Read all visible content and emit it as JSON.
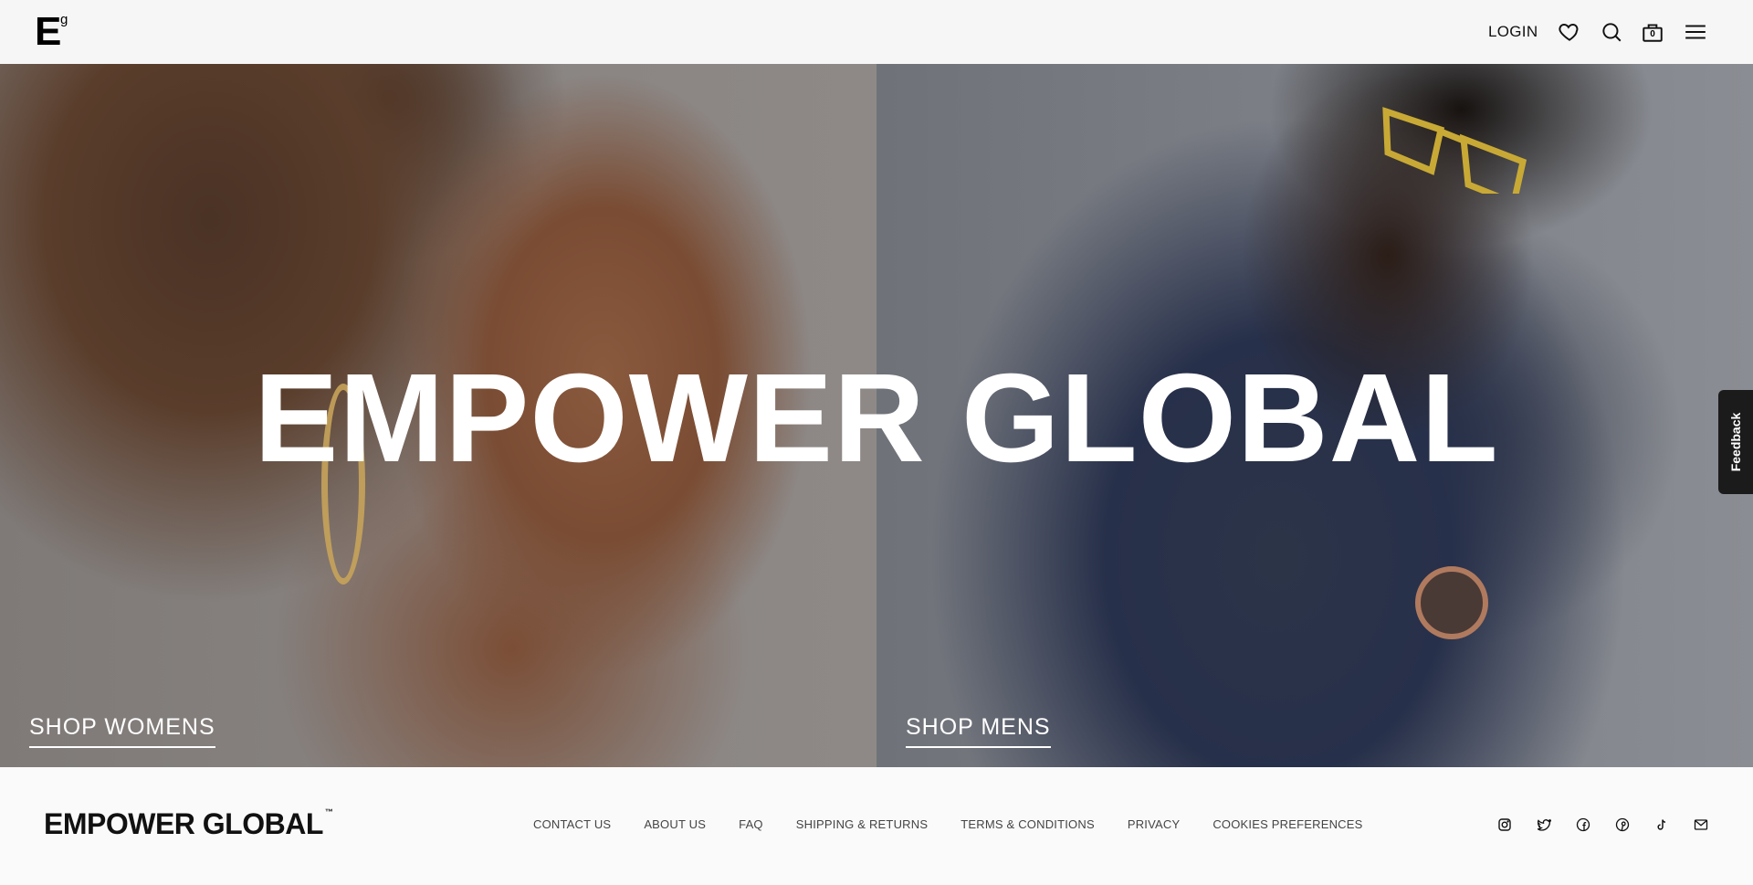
{
  "header": {
    "logo_letter": "E",
    "logo_small": "g",
    "login_label": "LOGIN",
    "cart_count": "0",
    "icons": [
      "heart-icon",
      "search-icon",
      "bag-icon",
      "menu-icon"
    ]
  },
  "hero": {
    "title": "EMPOWER GLOBAL",
    "shop_women_label": "SHOP WOMENS",
    "shop_men_label": "SHOP MENS"
  },
  "feedback": {
    "label": "Feedback"
  },
  "footer": {
    "brand": "EMPOWER GLOBAL",
    "brand_mark": "™",
    "nav": [
      {
        "label": "CONTACT US"
      },
      {
        "label": "ABOUT US"
      },
      {
        "label": "FAQ"
      },
      {
        "label": "SHIPPING & RETURNS"
      },
      {
        "label": "TERMS & CONDITIONS"
      },
      {
        "label": "PRIVACY"
      },
      {
        "label": "COOKIES PREFERENCES"
      }
    ],
    "social_icons": [
      "instagram-icon",
      "twitter-icon",
      "facebook-icon",
      "pinterest-icon",
      "tiktok-icon",
      "email-icon"
    ]
  },
  "colors": {
    "header_bg": "#f6f6f6",
    "footer_bg": "#fafafa",
    "text_dark": "#111111",
    "hero_text": "#ffffff",
    "feedback_bg": "#1b1b1b"
  }
}
